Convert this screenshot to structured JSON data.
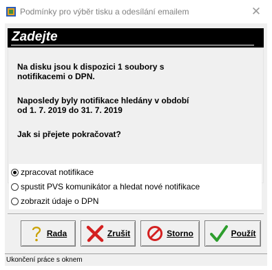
{
  "window": {
    "title": "Podmínky pro výběr tisku a odesílání emailem",
    "close_glyph": "✕",
    "icon": "app-book-icon"
  },
  "header": {
    "title": "Zadejte"
  },
  "message": {
    "line1": "Na disku jsou k dispozici 1 soubory s\nnotifikacemi o DPN.",
    "line2": "Naposledy byly notifikace hledány v období\nod 1. 7. 2019 do 31. 7. 2019",
    "line3": "Jak si přejete pokračovat?"
  },
  "options": [
    {
      "label": "zpracovat notifikace",
      "checked": true
    },
    {
      "label": "spustit PVS komunikátor a hledat nové notifikace",
      "checked": false
    },
    {
      "label": "zobrazit údaje o DPN",
      "checked": false
    }
  ],
  "buttons": {
    "help": {
      "label": "Rada",
      "icon": "question-mark-icon"
    },
    "cancel": {
      "label": "Zrušit",
      "icon": "red-x-icon"
    },
    "storno": {
      "label": "Storno",
      "icon": "no-entry-icon"
    },
    "apply": {
      "label": "Použít",
      "icon": "checkmark-icon"
    }
  },
  "status": {
    "text": "Ukončení práce s oknem"
  }
}
